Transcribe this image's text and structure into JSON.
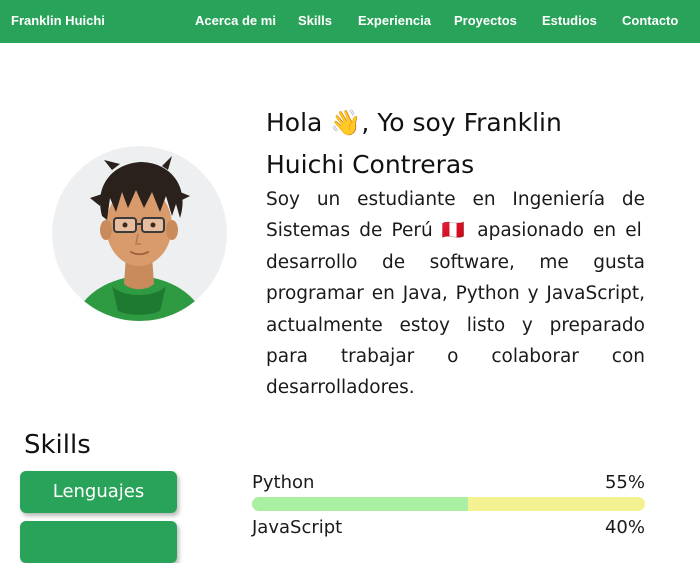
{
  "navbar": {
    "brand": "Franklin Huichi",
    "items": [
      {
        "label": "Acerca de mi"
      },
      {
        "label": "Skills"
      },
      {
        "label": "Experiencia"
      },
      {
        "label": "Proyectos"
      },
      {
        "label": "Estudios"
      },
      {
        "label": "Contacto"
      }
    ]
  },
  "intro": {
    "title": "Hola 👋, Yo soy Franklin Huichi Contreras",
    "text": "Soy un estudiante en Ingeniería de Sistemas de Perú 🇵🇪 apasionado en el desarrollo de software, me gusta programar en Java, Python y JavaScript, actualmente estoy listo y preparado para trabajar o colaborar con desarrolladores."
  },
  "skills": {
    "title": "Skills",
    "tabs": [
      {
        "label": "Lenguajes"
      },
      {
        "label": ""
      }
    ],
    "items": [
      {
        "name": "Python",
        "percent_label": "55%",
        "percent": 55
      },
      {
        "name": "JavaScript",
        "percent_label": "40%",
        "percent": 40
      }
    ]
  },
  "colors": {
    "primary": "#2aa35a",
    "bar_fill": "#a9f0a2",
    "bar_track": "#f4f191"
  }
}
